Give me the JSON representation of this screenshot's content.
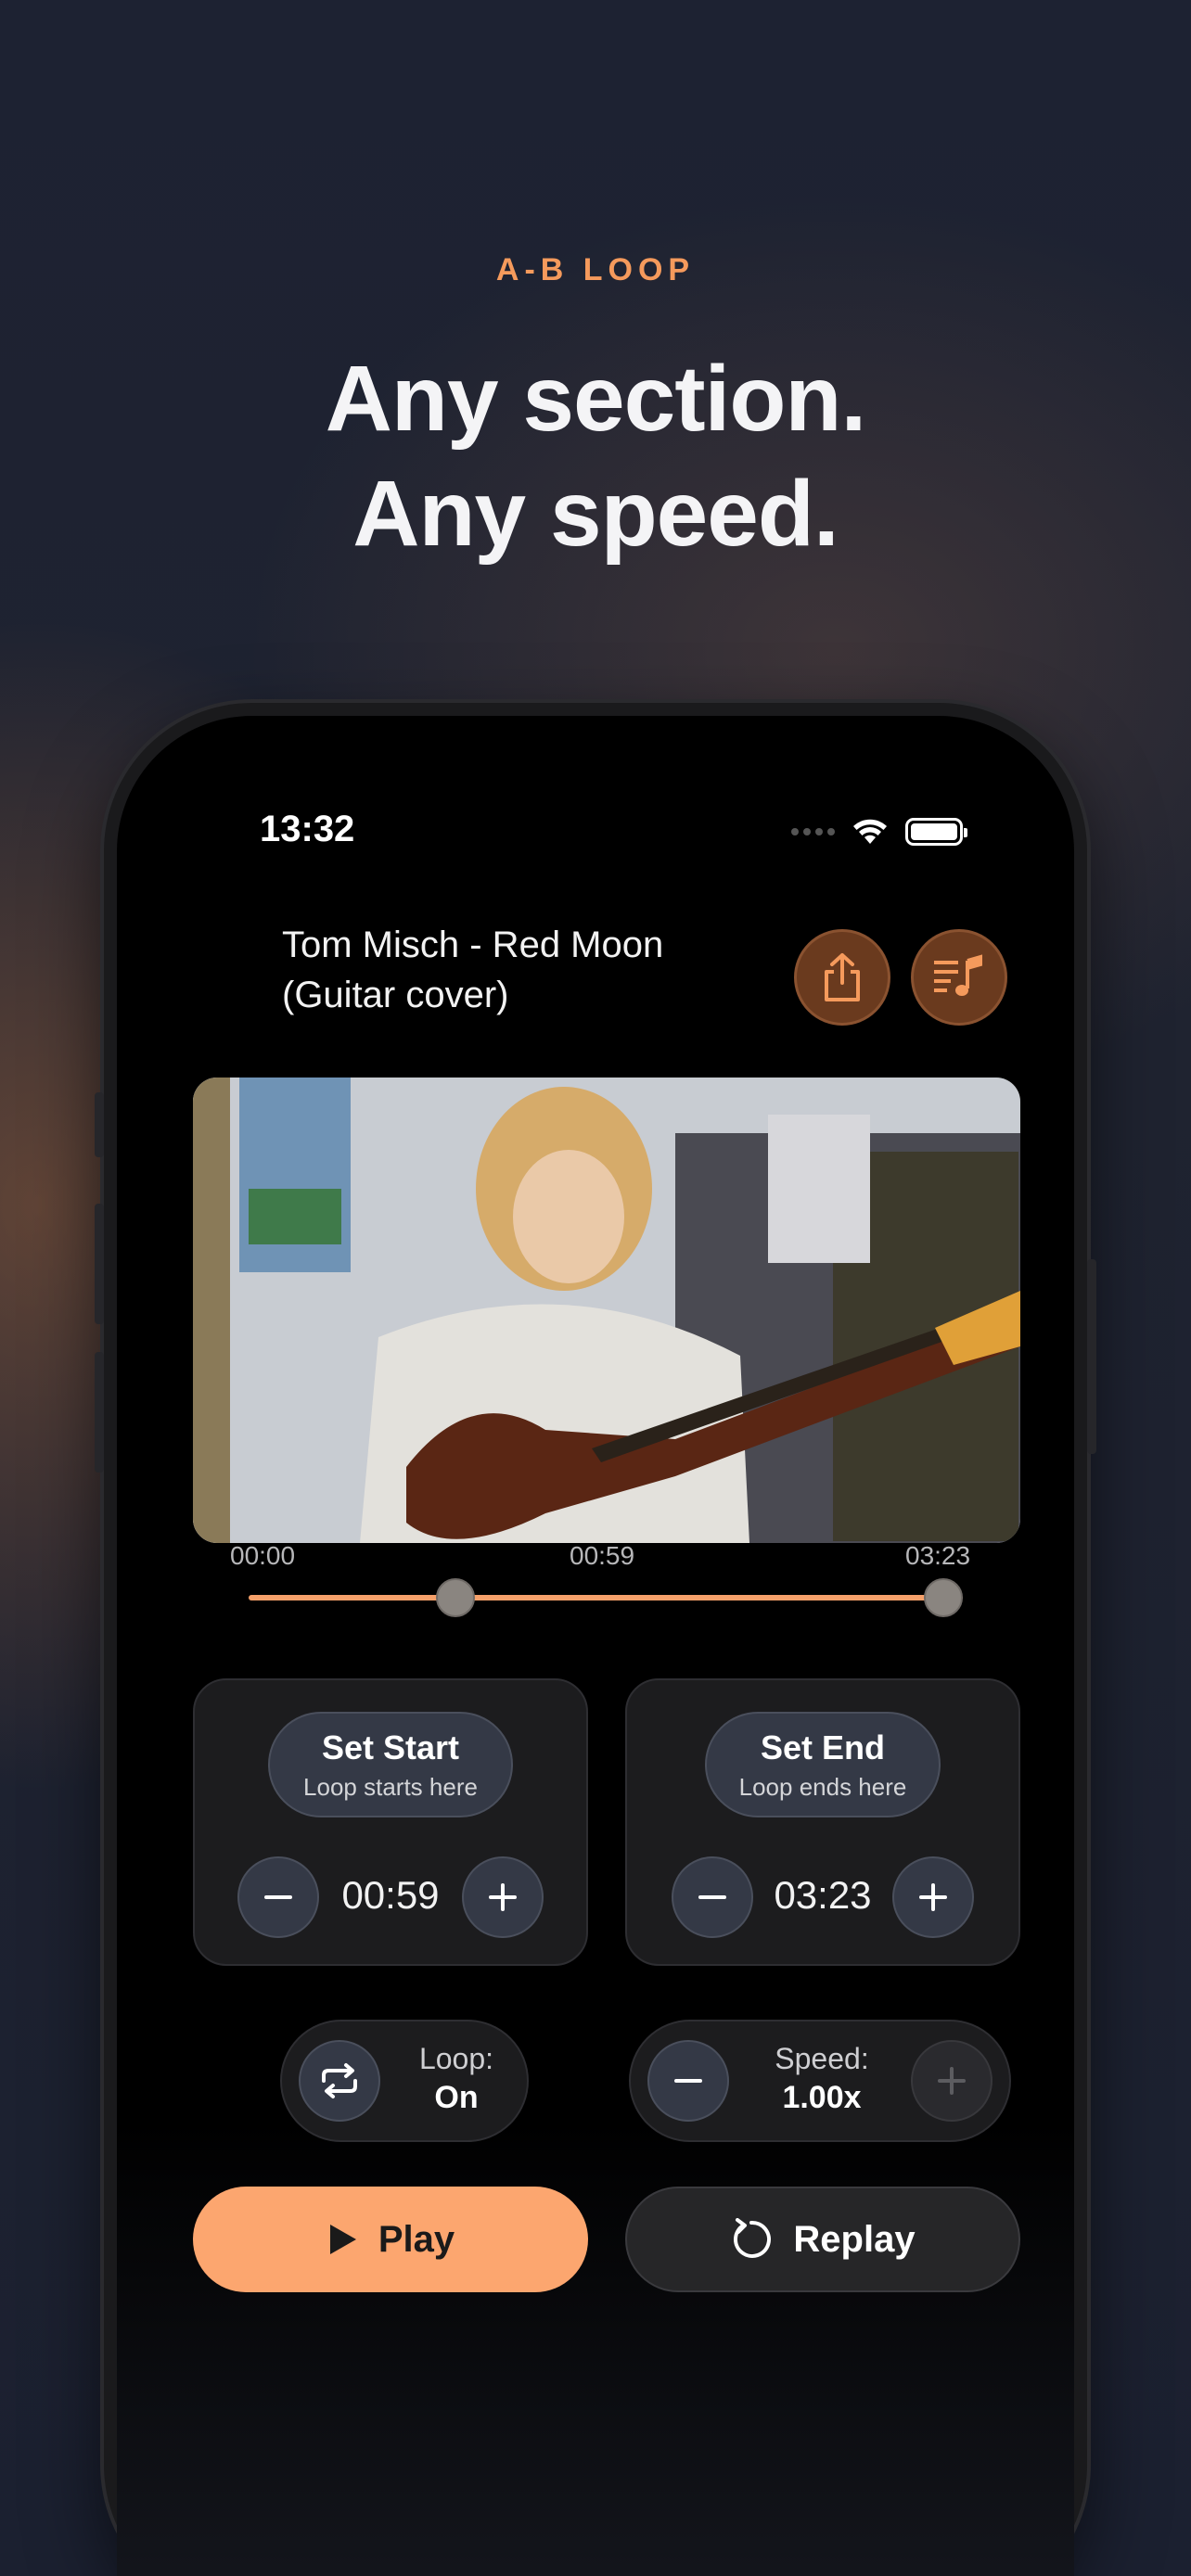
{
  "promo": {
    "eyebrow": "A-B LOOP",
    "headline_line1": "Any section.",
    "headline_line2": "Any speed."
  },
  "status_bar": {
    "time": "13:32",
    "icons": [
      "signal-dots-icon",
      "wifi-icon",
      "battery-icon"
    ]
  },
  "header": {
    "title": "Tom Misch - Red Moon (Guitar cover)",
    "buttons": [
      {
        "name": "share-button",
        "icon": "share-icon"
      },
      {
        "name": "playlist-button",
        "icon": "playlist-music-icon"
      }
    ]
  },
  "timeline": {
    "start_label": "00:00",
    "a_label": "00:59",
    "end_label": "03:23",
    "a_position_fraction": 0.29,
    "b_position_fraction": 1.0
  },
  "set_start": {
    "label": "Set Start",
    "sublabel": "Loop starts here",
    "value": "00:59"
  },
  "set_end": {
    "label": "Set End",
    "sublabel": "Loop ends here",
    "value": "03:23"
  },
  "loop": {
    "label": "Loop:",
    "value": "On"
  },
  "speed": {
    "label": "Speed:",
    "value": "1.00x"
  },
  "actions": {
    "play": "Play",
    "replay": "Replay"
  },
  "colors": {
    "accent": "#f59a5c",
    "play_button": "#fca66f",
    "background": "#1c2130"
  }
}
